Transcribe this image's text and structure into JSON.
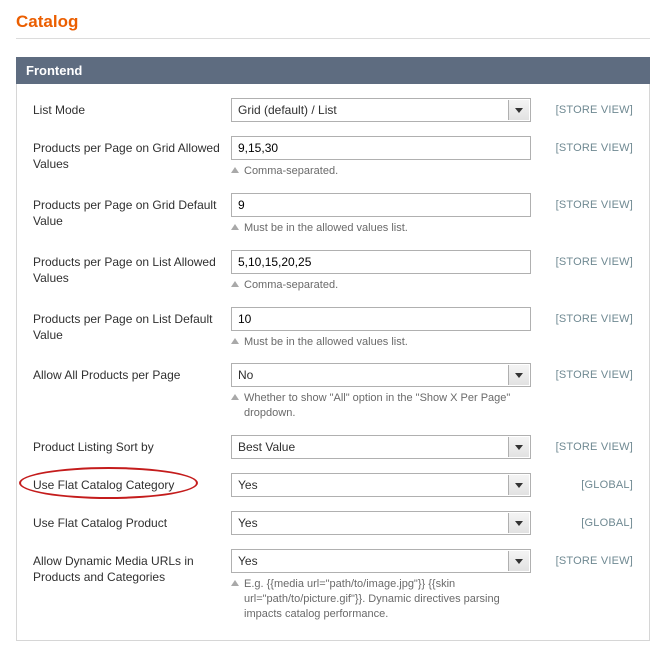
{
  "pageTitle": "Catalog",
  "section": {
    "title": "Frontend",
    "rows": [
      {
        "label": "List Mode",
        "control": "select",
        "value": "Grid (default) / List",
        "scope": "[STORE VIEW]"
      },
      {
        "label": "Products per Page on Grid Allowed Values",
        "control": "text",
        "value": "9,15,30",
        "hint": "Comma-separated.",
        "scope": "[STORE VIEW]"
      },
      {
        "label": "Products per Page on Grid Default Value",
        "control": "text",
        "value": "9",
        "hint": "Must be in the allowed values list.",
        "scope": "[STORE VIEW]"
      },
      {
        "label": "Products per Page on List Allowed Values",
        "control": "text",
        "value": "5,10,15,20,25",
        "hint": "Comma-separated.",
        "scope": "[STORE VIEW]"
      },
      {
        "label": "Products per Page on List Default Value",
        "control": "text",
        "value": "10",
        "hint": "Must be in the allowed values list.",
        "scope": "[STORE VIEW]"
      },
      {
        "label": "Allow All Products per Page",
        "control": "select",
        "value": "No",
        "hint": "Whether to show \"All\" option in the \"Show X Per Page\" dropdown.",
        "scope": "[STORE VIEW]"
      },
      {
        "label": "Product Listing Sort by",
        "control": "select",
        "value": "Best Value",
        "scope": "[STORE VIEW]"
      },
      {
        "label": "Use Flat Catalog Category",
        "control": "select",
        "value": "Yes",
        "scope": "[GLOBAL]",
        "highlighted": true
      },
      {
        "label": "Use Flat Catalog Product",
        "control": "select",
        "value": "Yes",
        "scope": "[GLOBAL]"
      },
      {
        "label": "Allow Dynamic Media URLs in Products and Categories",
        "control": "select",
        "value": "Yes",
        "hint": "E.g. {{media url=\"path/to/image.jpg\"}} {{skin url=\"path/to/picture.gif\"}}. Dynamic directives parsing impacts catalog performance.",
        "scope": "[STORE VIEW]"
      }
    ]
  }
}
